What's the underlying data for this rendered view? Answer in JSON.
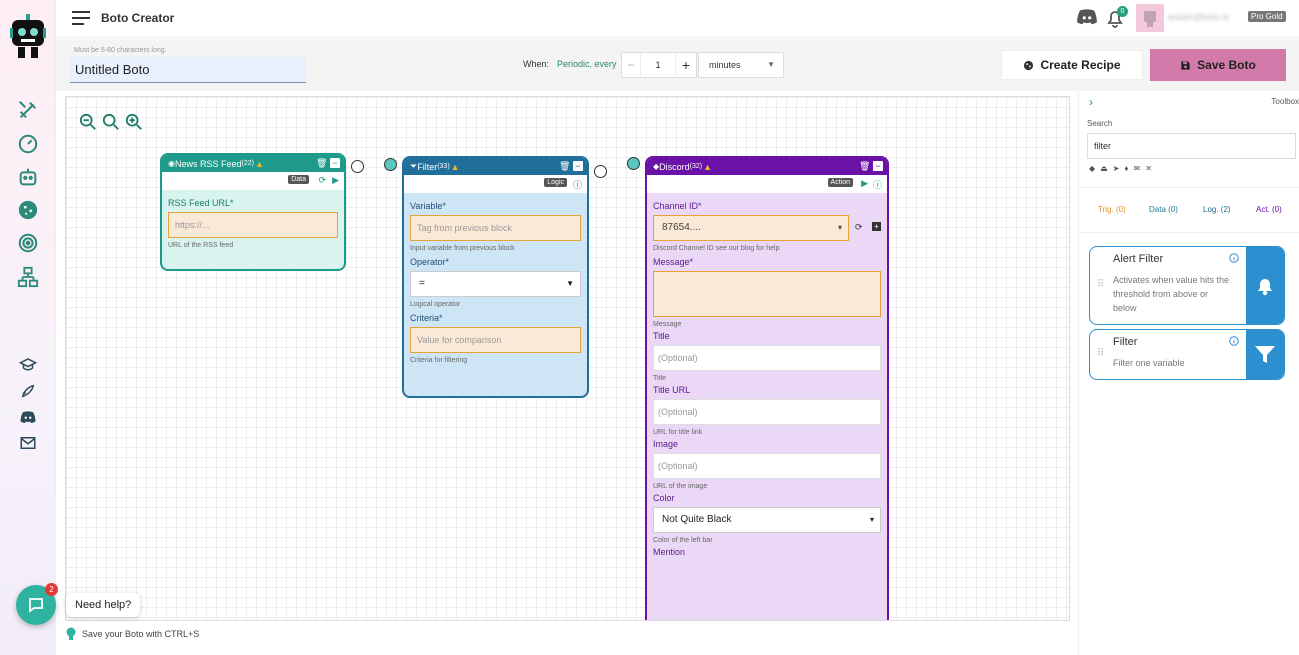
{
  "app": {
    "title": "Boto Creator",
    "notification_count": "0",
    "user_email": "leader@boto.io",
    "plan": "Pro Gold"
  },
  "boto_name": {
    "hint": "Must be 5-80 characters long.",
    "value": "Untitled Boto"
  },
  "schedule": {
    "when_label": "When:",
    "mode": "Periodic, every",
    "interval": "1",
    "unit": "minutes"
  },
  "actions": {
    "create_recipe": "Create Recipe",
    "save_boto": "Save Boto"
  },
  "nodes": {
    "rss": {
      "title": "News RSS Feed",
      "id": "(22)",
      "tag": "Data",
      "field_label": "RSS Feed URL*",
      "field_placeholder": "https://...",
      "field_help": "URL of the RSS feed"
    },
    "filter": {
      "title": "Filter",
      "id": "(33)",
      "tag": "Logic",
      "variable_label": "Variable*",
      "variable_placeholder": "Tag from previous block",
      "variable_help": "Input variable from previous block",
      "operator_label": "Operator*",
      "operator_value": "=",
      "operator_help": "Logical operator",
      "criteria_label": "Criteria*",
      "criteria_placeholder": "Value for comparison",
      "criteria_help": "Criteria for filtering"
    },
    "discord": {
      "title": "Discord",
      "id": "(32)",
      "tag": "Action",
      "channel_label": "Channel ID*",
      "channel_value": "87654....",
      "channel_help": "Discord Channel ID see our blog for help",
      "message_label": "Message*",
      "message_help": "Message",
      "title_label": "Title",
      "title_placeholder": "(Optional)",
      "title_help": "Title",
      "title_url_label": "Title URL",
      "title_url_placeholder": "(Optional)",
      "title_url_help": "URL for title link",
      "image_label": "Image",
      "image_placeholder": "(Optional)",
      "image_help": "URL of the image",
      "color_label": "Color",
      "color_value": "Not Quite Black",
      "color_help": "Color of the left bar",
      "mention_label": "Mention"
    }
  },
  "toolbox": {
    "title": "Toolbox",
    "search_label": "Search",
    "search_value": "filter",
    "tabs": {
      "trig": "Trig. (0)",
      "data": "Data (0)",
      "logic": "Log. (2)",
      "action": "Act. (0)"
    },
    "cards": [
      {
        "title": "Alert Filter",
        "description": "Activates when value hits the threshold from above or below",
        "icon": "bell-icon"
      },
      {
        "title": "Filter",
        "description": "Filter one variable",
        "icon": "funnel-icon"
      }
    ]
  },
  "footer": {
    "tip": "Save your Boto with CTRL+S",
    "need_help": "Need help?",
    "chat_badge": "2"
  },
  "colors": {
    "accent": "#2c8a7a",
    "save_button": "#d27baa",
    "rss_node": "#1f9a8a",
    "filter_node": "#1f6f9a",
    "discord_node": "#6a12a8"
  }
}
